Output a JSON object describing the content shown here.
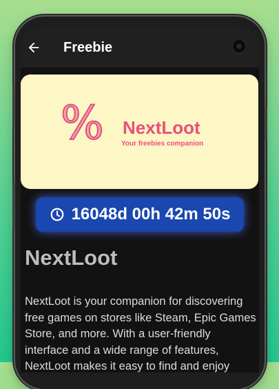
{
  "app_bar": {
    "title": "Freebie",
    "back_icon": "arrow-left-icon"
  },
  "banner": {
    "brand_name": "NextLoot",
    "tagline": "Your freebies companion",
    "percent_symbol": "%",
    "background_color": "#fdf6c5",
    "accent_color": "#e8507a"
  },
  "timer": {
    "icon": "clock-icon",
    "countdown": "16048d 00h 42m 50s",
    "background_color": "#1a47b0"
  },
  "game": {
    "title": "NextLoot",
    "description": "NextLoot is your companion for discovering free games on stores like Steam, Epic Games Store, and more. With a user-friendly interface and a wide range of features, NextLoot makes it easy to find and enjoy"
  }
}
